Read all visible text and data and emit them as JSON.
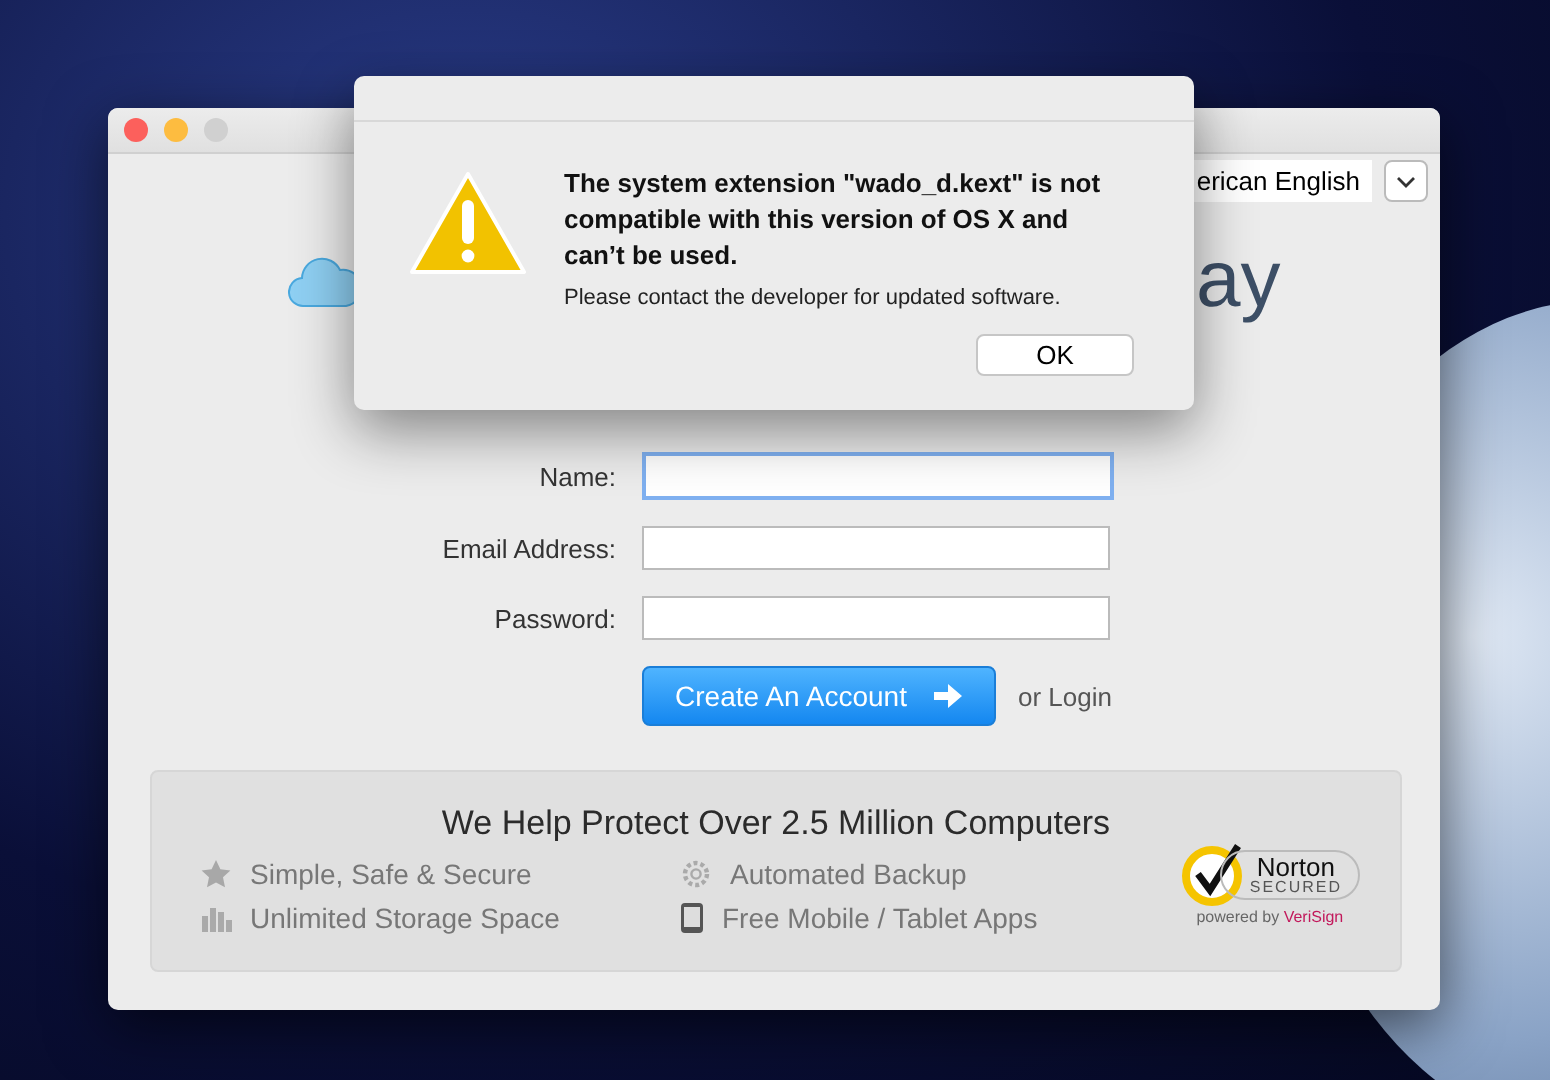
{
  "main_window": {
    "language_select": {
      "value": "erican English"
    },
    "logo_text": "ay",
    "form": {
      "fields": [
        {
          "label": "Name:",
          "focused": true
        },
        {
          "label": "Email Address:",
          "focused": false
        },
        {
          "label": "Password:",
          "focused": false
        }
      ],
      "submit": "Create An Account",
      "alt_link": "or Login"
    },
    "promo": {
      "heading": "We Help Protect Over 2.5 Million Computers",
      "features": [
        {
          "kind": "star",
          "text": "Simple, Safe & Secure"
        },
        {
          "kind": "gear",
          "text": "Automated Backup"
        },
        {
          "kind": "chart",
          "text": "Unlimited Storage Space"
        },
        {
          "kind": "tablet",
          "text": "Free Mobile / Tablet Apps"
        }
      ],
      "seal": {
        "name": "Norton",
        "status": "SECURED",
        "powered": "powered by",
        "brand": "VeriSign"
      }
    }
  },
  "alert": {
    "title": "The system extension \"wado_d.kext\" is not compatible with this version of OS X and can’t be used.",
    "message": "Please contact the developer for updated software.",
    "button": "OK"
  }
}
